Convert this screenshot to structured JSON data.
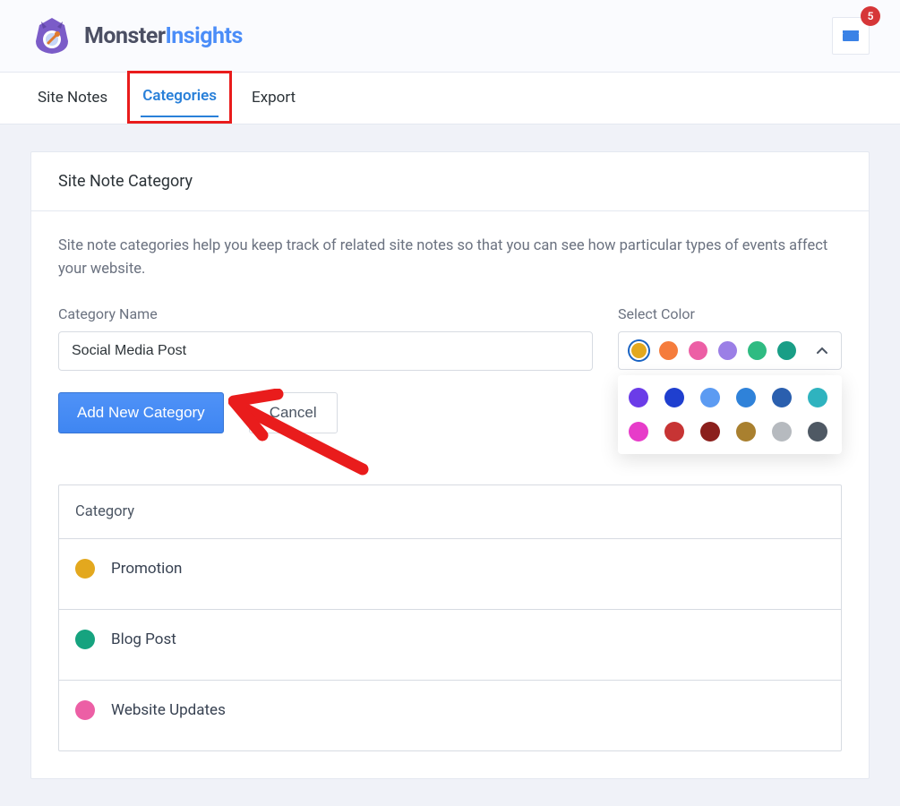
{
  "brand": {
    "part1": "Monster",
    "part2": "Insights"
  },
  "inbox": {
    "badge": "5"
  },
  "tabs": {
    "site_notes": "Site Notes",
    "categories": "Categories",
    "export": "Export"
  },
  "panel": {
    "title": "Site Note Category",
    "help": "Site note categories help you keep track of related site notes so that you can see how particular types of events affect your website."
  },
  "form": {
    "name_label": "Category Name",
    "name_value": "Social Media Post",
    "color_label": "Select Color",
    "add_label": "Add New Category",
    "cancel_label": "Cancel"
  },
  "color_select_row": [
    {
      "hex": "#E3A81E",
      "selected": true
    },
    {
      "hex": "#F57C3C"
    },
    {
      "hex": "#EC5FA5"
    },
    {
      "hex": "#9B7FE6"
    },
    {
      "hex": "#2FBB82"
    },
    {
      "hex": "#199E86"
    }
  ],
  "color_popover": [
    "#6B3CE8",
    "#1F3FCF",
    "#5C9BF2",
    "#2F82D9",
    "#2A5FAE",
    "#2FB3BF",
    "#E73CC9",
    "#C73434",
    "#8B1F1C",
    "#A9802F",
    "#B6BABF",
    "#4F5964"
  ],
  "table": {
    "header": "Category",
    "rows": [
      {
        "name": "Promotion",
        "color": "#E3A81E"
      },
      {
        "name": "Blog Post",
        "color": "#16A37F"
      },
      {
        "name": "Website Updates",
        "color": "#EC5FA5"
      }
    ]
  }
}
